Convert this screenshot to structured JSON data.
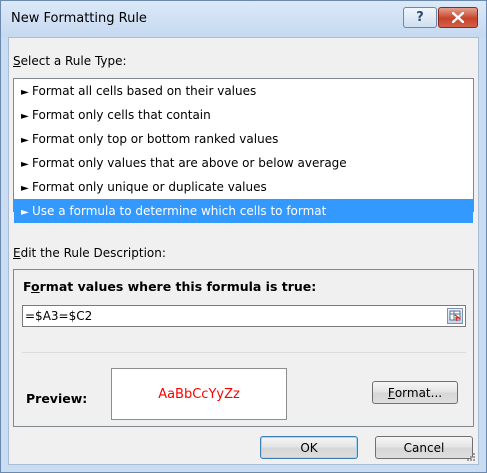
{
  "window": {
    "title": "New Formatting Rule",
    "help_glyph": "?"
  },
  "rule_type": {
    "label_mnemonic": "S",
    "label_rest": "elect a Rule Type:",
    "items": [
      "Format all cells based on their values",
      "Format only cells that contain",
      "Format only top or bottom ranked values",
      "Format only values that are above or below average",
      "Format only unique or duplicate values",
      "Use a formula to determine which cells to format"
    ],
    "selected_index": 5,
    "arrow_glyph": "►"
  },
  "description": {
    "label_mnemonic": "E",
    "label_rest": "dit the Rule Description:",
    "heading_pre": "F",
    "heading_mnemonic": "o",
    "heading_rest": "rmat values where this formula is true:",
    "formula": "=$A3=$C2",
    "preview_label": "Preview:",
    "preview_sample": "AaBbCcYyZz",
    "preview_color": "#ff0000",
    "format_mnemonic": "F",
    "format_rest": "ormat..."
  },
  "buttons": {
    "ok": "OK",
    "cancel": "Cancel"
  },
  "colors": {
    "selection": "#3399ff",
    "title_bar": "#c6d9f0",
    "close": "#c8432a"
  }
}
